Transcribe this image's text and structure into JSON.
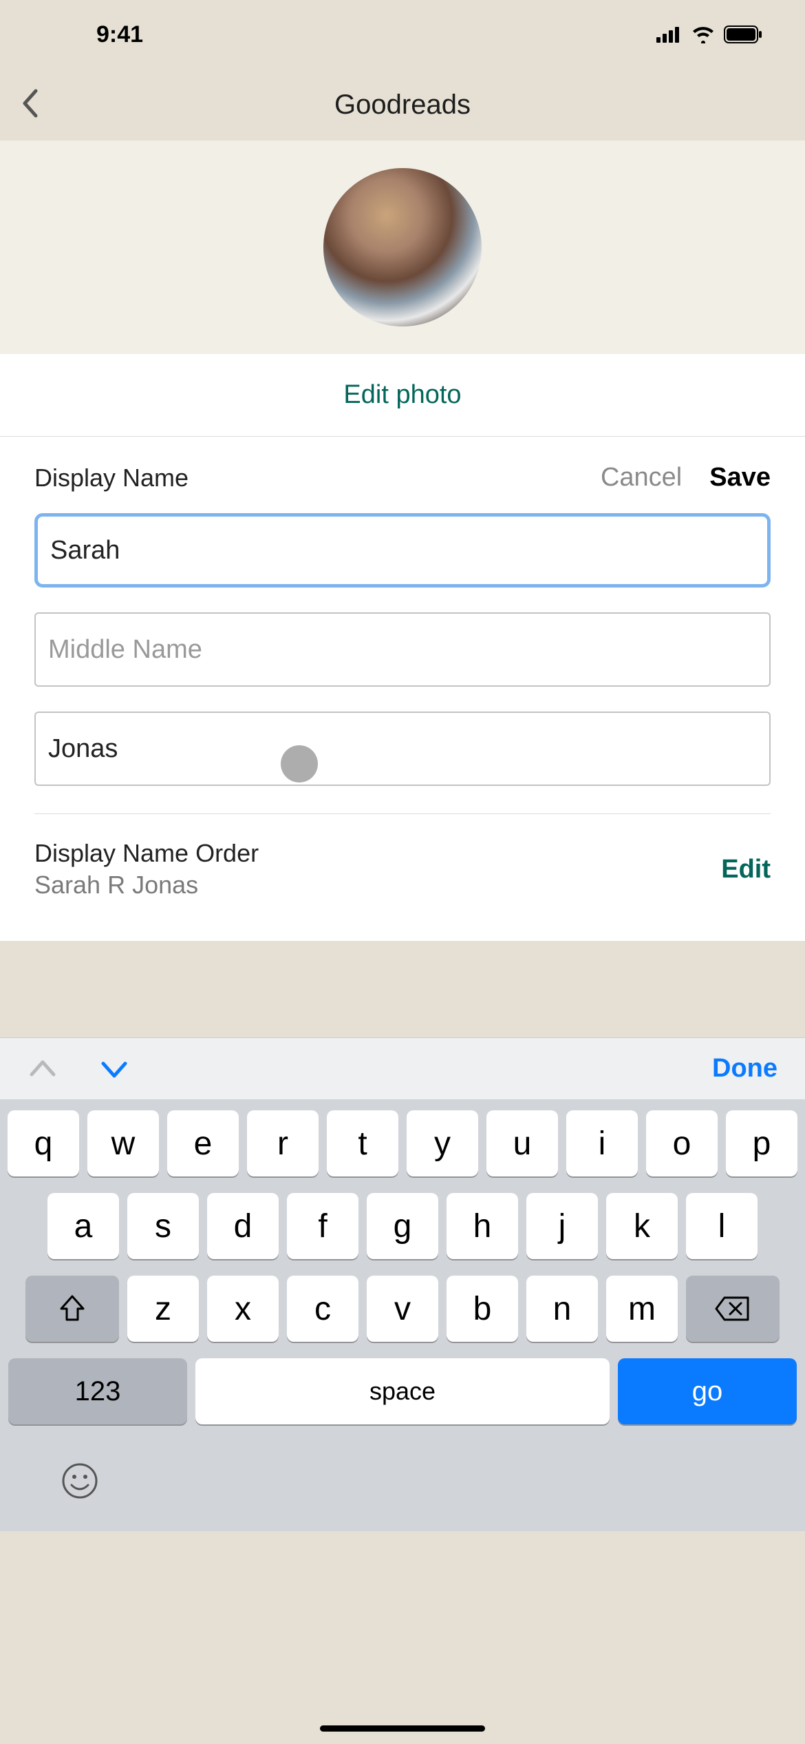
{
  "statusBar": {
    "time": "9:41"
  },
  "nav": {
    "title": "Goodreads"
  },
  "photo": {
    "editLabel": "Edit photo"
  },
  "form": {
    "displayNameLabel": "Display Name",
    "cancelLabel": "Cancel",
    "saveLabel": "Save",
    "firstName": "Sarah ",
    "middleName": "",
    "middleNamePlaceholder": "Middle Name",
    "lastName": "Jonas"
  },
  "order": {
    "label": "Display Name Order",
    "value": "Sarah R Jonas",
    "editLabel": "Edit"
  },
  "keyboard": {
    "doneLabel": "Done",
    "row1": [
      "q",
      "w",
      "e",
      "r",
      "t",
      "y",
      "u",
      "i",
      "o",
      "p"
    ],
    "row2": [
      "a",
      "s",
      "d",
      "f",
      "g",
      "h",
      "j",
      "k",
      "l"
    ],
    "row3": [
      "z",
      "x",
      "c",
      "v",
      "b",
      "n",
      "m"
    ],
    "numLabel": "123",
    "spaceLabel": "space",
    "goLabel": "go"
  }
}
